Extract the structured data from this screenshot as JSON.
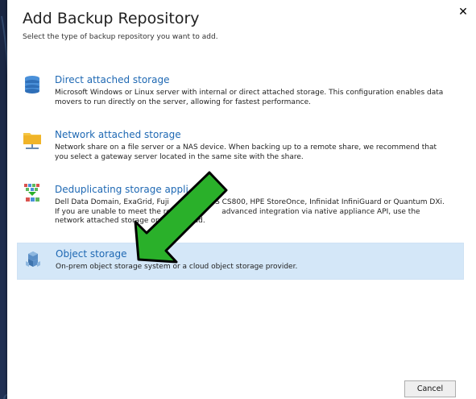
{
  "dialog": {
    "title": "Add Backup Repository",
    "subtitle": "Select the type of backup repository you want to add.",
    "close_glyph": "✕"
  },
  "options": [
    {
      "title": "Direct attached storage",
      "description": "Microsoft Windows or Linux server with internal or direct attached storage. This configuration enables data movers to run directly on the server, allowing for fastest performance.",
      "icon": "database-icon",
      "selected": false
    },
    {
      "title": "Network attached storage",
      "description": "Network share on a file server or a NAS device. When backing up to a remote share, we recommend that you select a gateway server located in the same site with the share.",
      "icon": "folder-icon",
      "selected": false
    },
    {
      "title": "Deduplicating storage appli",
      "description": "Dell Data Domain, ExaGrid, Fuji                    S CS800, HPE StoreOnce, Infinidat InfiniGuard or Quantum DXi. If you are unable to meet the requir                advanced integration via native appliance API, use the network attached storage option instead.",
      "icon": "dedup-icon",
      "selected": false
    },
    {
      "title": "Object storage",
      "description": "On-prem object storage system or a cloud object storage provider.",
      "icon": "cubes-icon",
      "selected": true
    }
  ],
  "footer": {
    "cancel_label": "Cancel"
  },
  "colors": {
    "link_blue": "#1e68b3",
    "selected_bg": "#d4e7f8",
    "arrow_green": "#2ab02a"
  }
}
